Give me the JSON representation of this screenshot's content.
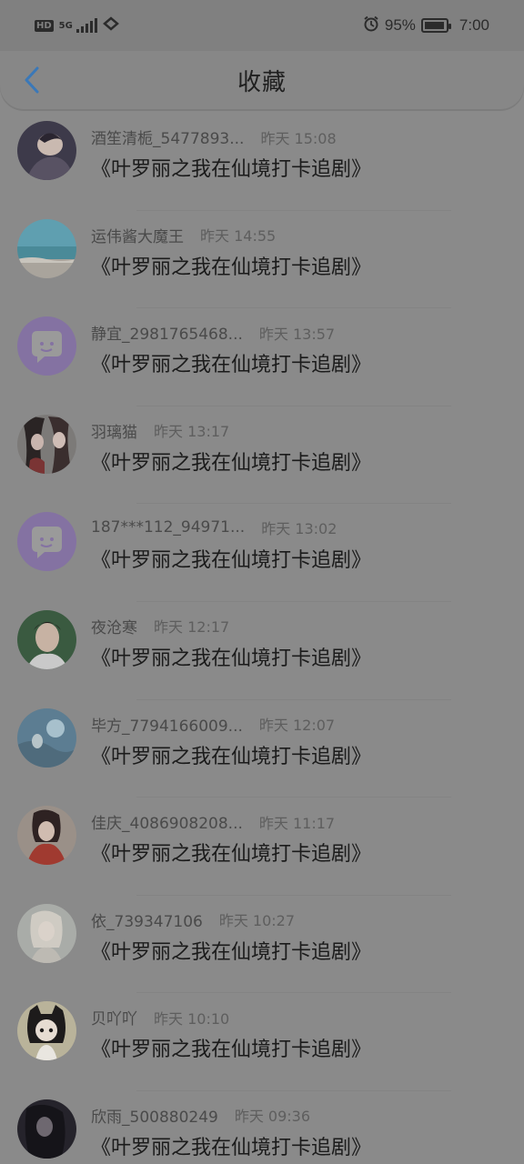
{
  "status_bar": {
    "hd": "HD",
    "network": "5G",
    "battery_percent": "95%",
    "battery_level": 0.95,
    "time": "7:00",
    "icons": [
      "hd-icon",
      "signal-icon",
      "wifi-icon",
      "alarm-icon",
      "battery-icon"
    ]
  },
  "header": {
    "title": "收藏",
    "back_icon": "chevron-left-icon",
    "back_color": "#3a78b8"
  },
  "items": [
    {
      "name": "酒笙清栀_5477893...",
      "time": "昨天 15:08",
      "title": "《叶罗丽之我在仙境打卡追剧》",
      "avatar": "photo"
    },
    {
      "name": "运伟酱大魔王",
      "time": "昨天 14:55",
      "title": "《叶罗丽之我在仙境打卡追剧》",
      "avatar": "sea"
    },
    {
      "name": "静宜_2981765468...",
      "time": "昨天 13:57",
      "title": "《叶罗丽之我在仙境打卡追剧》",
      "avatar": "default"
    },
    {
      "name": "羽璃猫",
      "time": "昨天 13:17",
      "title": "《叶罗丽之我在仙境打卡追剧》",
      "avatar": "anime-pair"
    },
    {
      "name": "187***112_94971...",
      "time": "昨天 13:02",
      "title": "《叶罗丽之我在仙境打卡追剧》",
      "avatar": "default"
    },
    {
      "name": "夜沧寒",
      "time": "昨天 12:17",
      "title": "《叶罗丽之我在仙境打卡追剧》",
      "avatar": "portrait"
    },
    {
      "name": "毕方_7794166009...",
      "time": "昨天 12:07",
      "title": "《叶罗丽之我在仙境打卡追剧》",
      "avatar": "blue-anime"
    },
    {
      "name": "佳庆_4086908208...",
      "time": "昨天 11:17",
      "title": "《叶罗丽之我在仙境打卡追剧》",
      "avatar": "red-anime"
    },
    {
      "name": "依_739347106",
      "time": "昨天 10:27",
      "title": "《叶罗丽之我在仙境打卡追剧》",
      "avatar": "pale-anime"
    },
    {
      "name": "贝吖吖",
      "time": "昨天 10:10",
      "title": "《叶罗丽之我在仙境打卡追剧》",
      "avatar": "chibi"
    },
    {
      "name": "欣雨_500880249",
      "time": "昨天 09:36",
      "title": "《叶罗丽之我在仙境打卡追剧》",
      "avatar": "dark-anime"
    }
  ]
}
